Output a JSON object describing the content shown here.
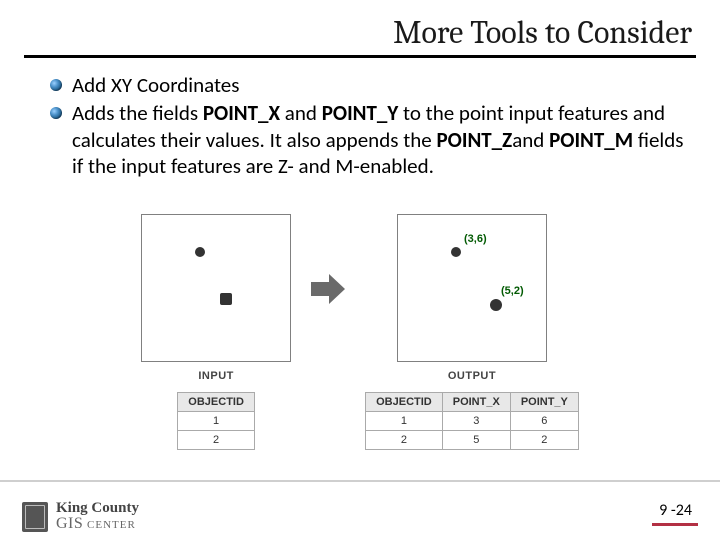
{
  "title": "More Tools to Consider",
  "bullets": {
    "b1": "Add XY Coordinates",
    "b2": {
      "pre": "Adds the fields ",
      "px": "POINT_X",
      "and1": " and ",
      "py": "POINT_Y",
      "mid": " to the point input features and calculates their values. It also appends the ",
      "pz": "POINT_Z",
      "and2": "and ",
      "pm": "POINT_M",
      "post": " fields if the input features are Z- and M-enabled."
    }
  },
  "diagram": {
    "input_caption": "INPUT",
    "output_caption": "OUTPUT",
    "input_headers": [
      "OBJECTID"
    ],
    "input_rows": [
      [
        "1"
      ],
      [
        "2"
      ]
    ],
    "output_headers": [
      "OBJECTID",
      "POINT_X",
      "POINT_Y"
    ],
    "output_rows": [
      [
        "1",
        "3",
        "6"
      ],
      [
        "2",
        "5",
        "2"
      ]
    ],
    "output_labels": {
      "p1": "(3,6)",
      "p2": "(5,2)"
    }
  },
  "footer": {
    "county": "King County",
    "gis": "GIS",
    "center": " CENTER",
    "page": "9 -24"
  }
}
